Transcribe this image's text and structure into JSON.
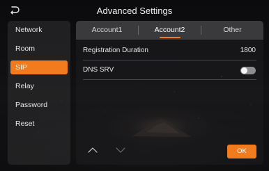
{
  "header": {
    "title": "Advanced Settings",
    "back_icon": "back-arrow-icon"
  },
  "sidebar": {
    "items": [
      {
        "label": "Network",
        "active": false
      },
      {
        "label": "Room",
        "active": false
      },
      {
        "label": "SIP",
        "active": true
      },
      {
        "label": "Relay",
        "active": false
      },
      {
        "label": "Password",
        "active": false
      },
      {
        "label": "Reset",
        "active": false
      }
    ]
  },
  "tabs": [
    {
      "label": "Account1",
      "active": false
    },
    {
      "label": "Account2",
      "active": true
    },
    {
      "label": "Other",
      "active": false
    }
  ],
  "settings": {
    "registration_duration": {
      "label": "Registration Duration",
      "value": "1800"
    },
    "dns_srv": {
      "label": "DNS SRV",
      "enabled": false
    }
  },
  "footer": {
    "ok_label": "OK",
    "up_icon": "chevron-up-icon",
    "down_icon": "chevron-down-icon"
  },
  "colors": {
    "accent": "#f27b1e",
    "background": "#0e0e10"
  }
}
